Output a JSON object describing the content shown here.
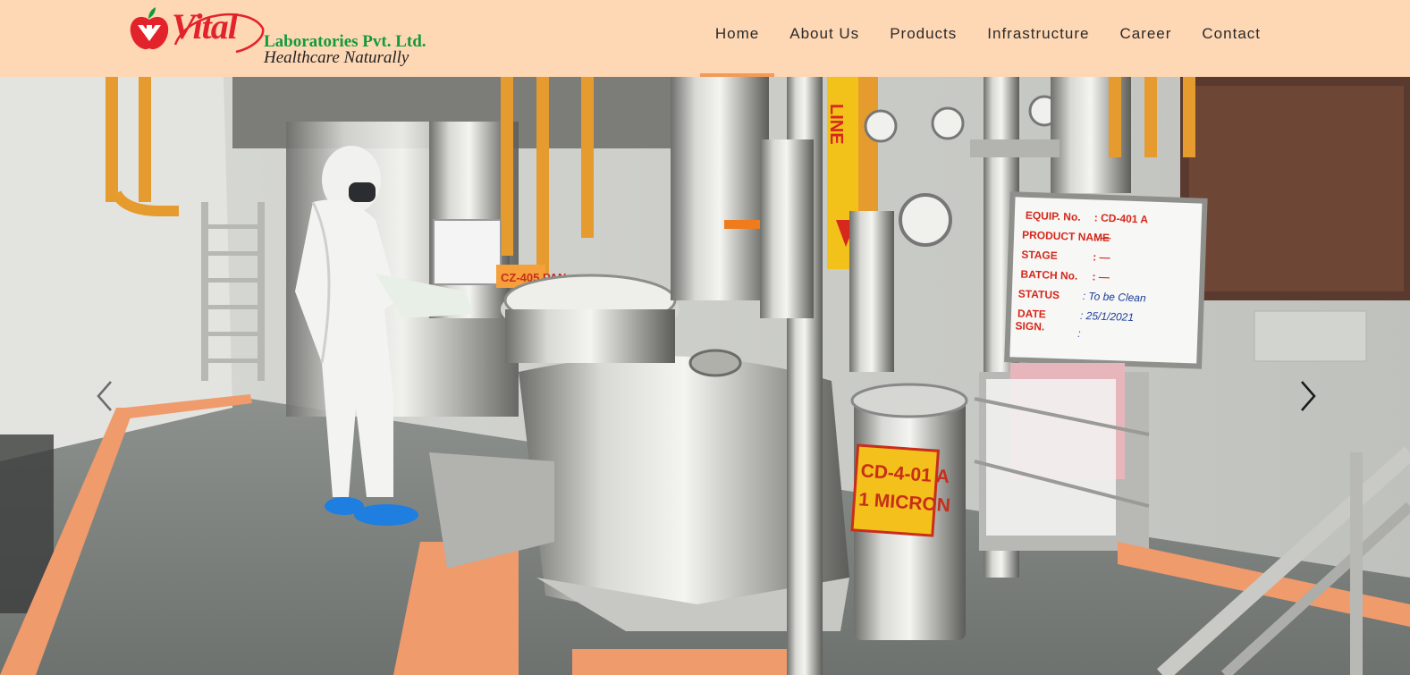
{
  "brand": {
    "logo_word": "Vital",
    "company": "Laboratories Pvt. Ltd.",
    "tagline": "Healthcare Naturally",
    "colors": {
      "red": "#e3232b",
      "green": "#129a3f",
      "header_bg": "#fed7b4",
      "active_underline": "#f39a5b"
    }
  },
  "nav": {
    "items": [
      {
        "label": "Home",
        "active": true
      },
      {
        "label": "About Us"
      },
      {
        "label": "Products"
      },
      {
        "label": "Infrastructure"
      },
      {
        "label": "Career"
      },
      {
        "label": "Contact"
      }
    ]
  },
  "slider": {
    "prev_icon": "chevron-left-icon",
    "next_icon": "chevron-right-icon",
    "equipment_board": {
      "equip_no_label": "EQUIP. No.",
      "equip_no_value": ": CD-401 A",
      "product_name_label": "PRODUCT NAME",
      "product_name_value": ":   —",
      "stage_label": "STAGE",
      "stage_value": ":   —",
      "batch_label": "BATCH No.",
      "batch_value": ":   —",
      "status_label": "STATUS",
      "status_value": ": To be Clean",
      "date_label": "DATE",
      "date_value": ": 25/1/2021",
      "sign_label": "SIGN.",
      "sign_value": ":"
    },
    "tank_tag_line1": "CD-4-01 A",
    "tank_tag_line2": "1 MICRON",
    "line_tag": "LINE",
    "panel_tag": "CZ-405 PAN"
  }
}
